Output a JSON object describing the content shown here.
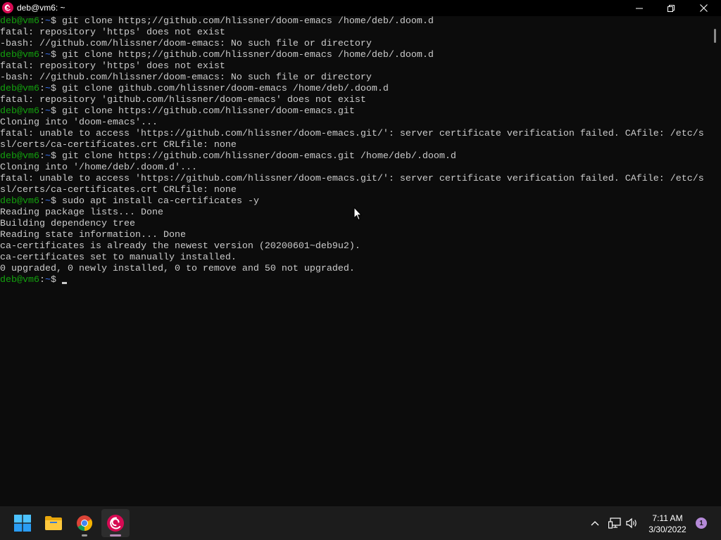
{
  "window": {
    "title": "deb@vm6: ~",
    "controls": {
      "minimize_icon": "minimize-icon",
      "maximize_icon": "restore-icon",
      "close_icon": "close-icon"
    }
  },
  "terminal": {
    "prompt_user": "deb@vm6",
    "prompt_path": "~",
    "lines": [
      {
        "type": "cmd",
        "text": "git clone https;//github.com/hlissner/doom-emacs /home/deb/.doom.d"
      },
      {
        "type": "out",
        "text": "fatal: repository 'https' does not exist"
      },
      {
        "type": "out",
        "text": "-bash: //github.com/hlissner/doom-emacs: No such file or directory"
      },
      {
        "type": "cmd",
        "text": "git clone https;//github.com/hlissner/doom-emacs /home/deb/.doom.d"
      },
      {
        "type": "out",
        "text": "fatal: repository 'https' does not exist"
      },
      {
        "type": "out",
        "text": "-bash: //github.com/hlissner/doom-emacs: No such file or directory"
      },
      {
        "type": "cmd",
        "text": "git clone github.com/hlissner/doom-emacs /home/deb/.doom.d"
      },
      {
        "type": "out",
        "text": "fatal: repository 'github.com/hlissner/doom-emacs' does not exist"
      },
      {
        "type": "cmd",
        "text": "git clone https://github.com/hlissner/doom-emacs.git"
      },
      {
        "type": "out",
        "text": "Cloning into 'doom-emacs'..."
      },
      {
        "type": "out",
        "text": "fatal: unable to access 'https://github.com/hlissner/doom-emacs.git/': server certificate verification failed. CAfile: /etc/s"
      },
      {
        "type": "out",
        "text": "sl/certs/ca-certificates.crt CRLfile: none"
      },
      {
        "type": "cmd",
        "text": "git clone https://github.com/hlissner/doom-emacs.git /home/deb/.doom.d"
      },
      {
        "type": "out",
        "text": "Cloning into '/home/deb/.doom.d'..."
      },
      {
        "type": "out",
        "text": "fatal: unable to access 'https://github.com/hlissner/doom-emacs.git/': server certificate verification failed. CAfile: /etc/s"
      },
      {
        "type": "out",
        "text": "sl/certs/ca-certificates.crt CRLfile: none"
      },
      {
        "type": "cmd",
        "text": "sudo apt install ca-certificates -y"
      },
      {
        "type": "out",
        "text": "Reading package lists... Done"
      },
      {
        "type": "out",
        "text": "Building dependency tree"
      },
      {
        "type": "out",
        "text": "Reading state information... Done"
      },
      {
        "type": "out",
        "text": "ca-certificates is already the newest version (20200601~deb9u2)."
      },
      {
        "type": "out",
        "text": "ca-certificates set to manually installed."
      },
      {
        "type": "out",
        "text": "0 upgraded, 0 newly installed, 0 to remove and 50 not upgraded."
      },
      {
        "type": "current",
        "text": ""
      }
    ]
  },
  "taskbar": {
    "apps": [
      {
        "name": "start",
        "icon": "windows-logo-icon"
      },
      {
        "name": "file-explorer",
        "icon": "folder-icon"
      },
      {
        "name": "chrome",
        "icon": "chrome-icon"
      },
      {
        "name": "debian-terminal",
        "icon": "debian-swirl-icon"
      }
    ],
    "tray": {
      "chevron_icon": "chevron-up-icon",
      "network_icon": "network-icon",
      "volume_icon": "volume-icon",
      "time": "7:11 AM",
      "date": "3/30/2022",
      "notification_count": "1"
    }
  },
  "colors": {
    "terminal_bg": "#0c0c0c",
    "terminal_fg": "#cccccc",
    "prompt_user": "#13a10e",
    "prompt_path": "#3b78ff",
    "taskbar_bg": "#1c1c1c",
    "debian_red": "#d70a53"
  }
}
